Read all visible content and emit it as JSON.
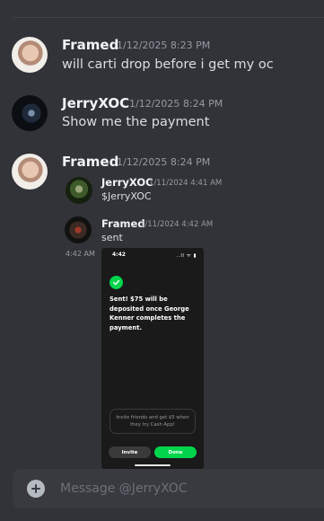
{
  "messages": [
    {
      "author": "Framed",
      "timestamp": "1/12/2025 8:23 PM",
      "text": "will carti drop before i get my oc"
    },
    {
      "author": "JerryXOC",
      "timestamp": "1/12/2025 8:24 PM",
      "text": "Show me the payment"
    },
    {
      "author": "Framed",
      "timestamp": "1/12/2025 8:24 PM",
      "forwarded": [
        {
          "author": "JerryXOC",
          "timestamp": "1/11/2024 4:41 AM",
          "text": "$JerryXOC"
        },
        {
          "author": "Framed",
          "timestamp": "1/11/2024 4:42 AM",
          "text": "sent",
          "side_time": "4:42 AM"
        }
      ]
    }
  ],
  "payment_screenshot": {
    "status_time": "4:42",
    "status_icons": "..ll ᯤ ▮",
    "message": "Sent! $75 will be deposited once George Kenner completes the payment.",
    "invite_text": "Invite friends and get $5 when they try Cash App!",
    "invite_button": "Invite",
    "done_button": "Done",
    "accent": "#00d54b"
  },
  "composer": {
    "placeholder": "Message @JerryXOC"
  }
}
